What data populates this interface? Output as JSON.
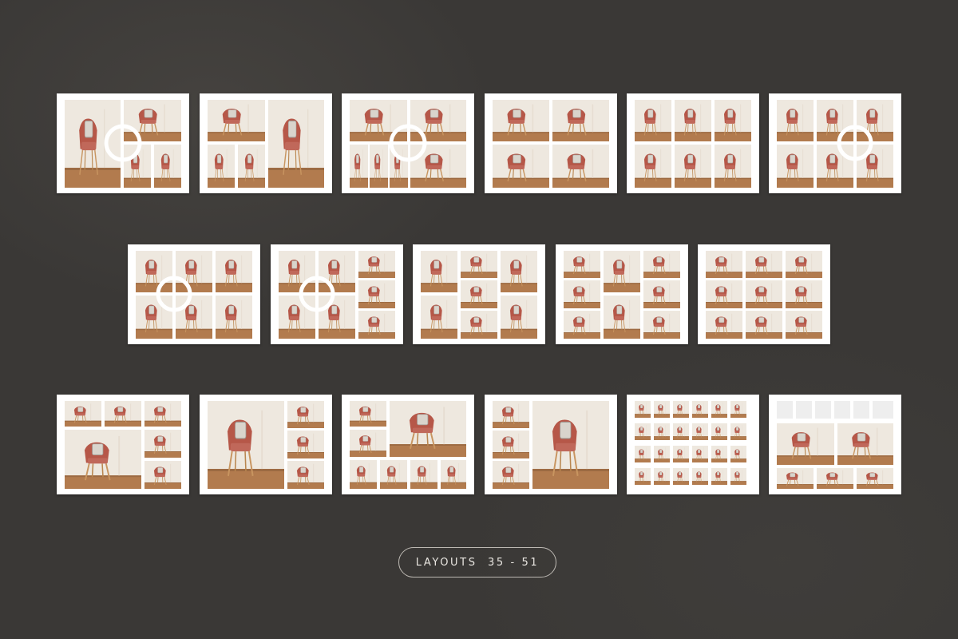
{
  "caption": {
    "label": "LAYOUTS  35 - 51"
  },
  "layouts": [
    {
      "id": 35,
      "icon": "photo-collage-icon"
    },
    {
      "id": 36,
      "icon": "photo-collage-icon"
    },
    {
      "id": 37,
      "icon": "photo-collage-icon"
    },
    {
      "id": 38,
      "icon": "photo-collage-icon"
    },
    {
      "id": 39,
      "icon": "photo-collage-icon"
    },
    {
      "id": 40,
      "icon": "photo-collage-icon"
    },
    {
      "id": 41,
      "icon": "photo-collage-icon"
    },
    {
      "id": 42,
      "icon": "photo-collage-icon"
    },
    {
      "id": 43,
      "icon": "photo-collage-icon"
    },
    {
      "id": 44,
      "icon": "photo-collage-icon"
    },
    {
      "id": 45,
      "icon": "photo-collage-icon"
    },
    {
      "id": 46,
      "icon": "photo-collage-icon"
    },
    {
      "id": 47,
      "icon": "photo-collage-icon"
    },
    {
      "id": 48,
      "icon": "photo-collage-icon"
    },
    {
      "id": 49,
      "icon": "photo-collage-icon"
    },
    {
      "id": 50,
      "icon": "photo-collage-icon"
    },
    {
      "id": 51,
      "icon": "photo-collage-icon"
    }
  ],
  "colors": {
    "background": "#3a3836",
    "board": "#ffffff",
    "wall": "#f1ece5",
    "floor": "#b07a4c",
    "chair": "#b85a4c",
    "placeholder": "#eeeeee",
    "caption_text": "#e9e6e1"
  }
}
